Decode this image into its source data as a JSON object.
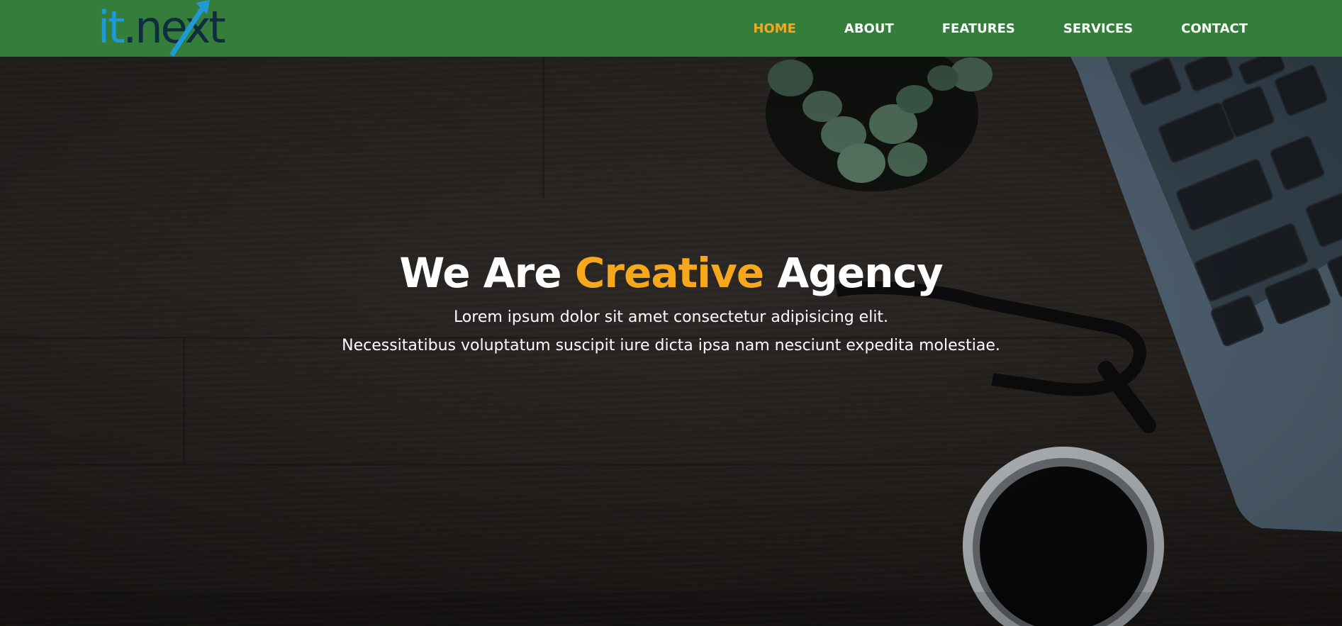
{
  "brand": {
    "logo_it": "it",
    "logo_dot": ".",
    "logo_ne": "ne",
    "logo_xt": "xt",
    "colors": {
      "nav_bg": "#357d3b",
      "accent": "#f6a81c",
      "logo_blue": "#1f9ad6",
      "logo_dark": "#0f2d3c"
    }
  },
  "nav": {
    "items": [
      {
        "label": "HOME",
        "active": true
      },
      {
        "label": "ABOUT",
        "active": false
      },
      {
        "label": "FEATURES",
        "active": false
      },
      {
        "label": "SERVICES",
        "active": false
      },
      {
        "label": "CONTACT",
        "active": false
      }
    ]
  },
  "hero": {
    "title_pre": "We Are ",
    "title_accent": "Creative",
    "title_post": " Agency",
    "subtitle_line1": "Lorem ipsum dolor sit amet consectetur adipisicing elit.",
    "subtitle_line2": "Necessitatibus voluptatum suscipit iure dicta ipsa nam nesciunt expedita molestiae.",
    "background_icons": [
      "plant-icon",
      "glasses-icon",
      "coffee-cup-icon",
      "laptop-keyboard-icon"
    ]
  }
}
